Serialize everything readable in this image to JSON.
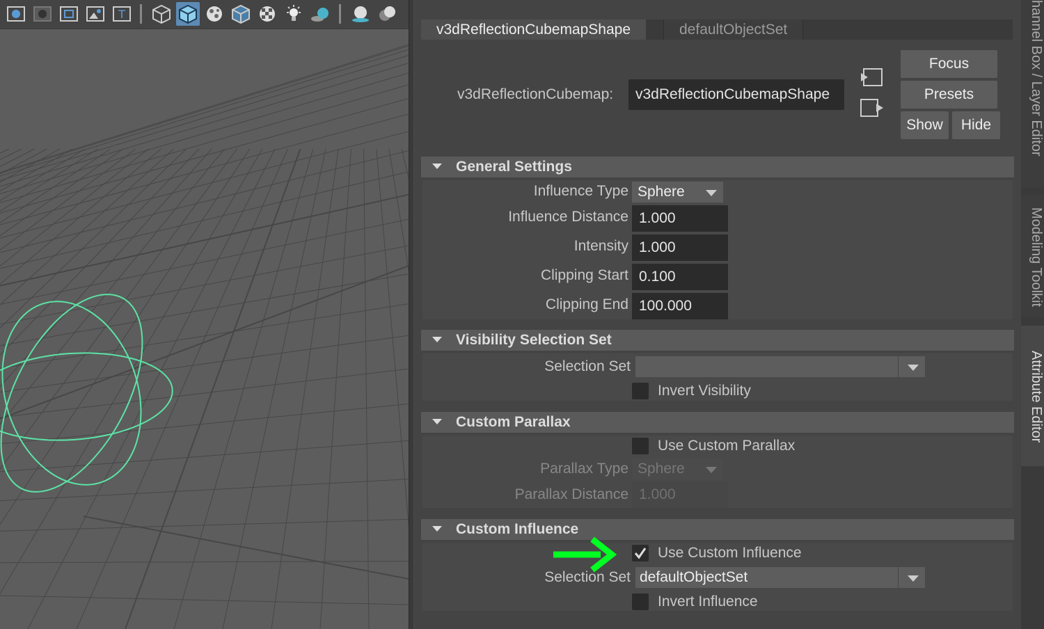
{
  "viewport": {
    "toolbar_icons": [
      "wireframe-on-shaded-icon",
      "shaded-icon",
      "frame-icon",
      "image-plane-icon",
      "texture-icon",
      "wireframe-cube-icon",
      "smooth-shaded-cube-icon",
      "isolate-icon",
      "xray-cube-icon",
      "checker-icon",
      "light-icon",
      "shadow-icon",
      "ambient-occlusion-icon",
      "motion-blur-icon"
    ],
    "colors": {
      "grid": "#474747",
      "curve": "#5ce3a6",
      "background": "#5d5d5d"
    }
  },
  "tabs": {
    "active": "v3dReflectionCubemapShape",
    "inactive": "defaultObjectSet"
  },
  "node": {
    "label": "v3dReflectionCubemap:",
    "value": "v3dReflectionCubemapShape"
  },
  "buttons": {
    "focus": "Focus",
    "presets": "Presets",
    "show": "Show",
    "hide": "Hide"
  },
  "general": {
    "title": "General Settings",
    "influence_type_label": "Influence Type",
    "influence_type_value": "Sphere",
    "influence_distance_label": "Influence Distance",
    "influence_distance_value": "1.000",
    "intensity_label": "Intensity",
    "intensity_value": "1.000",
    "clipping_start_label": "Clipping Start",
    "clipping_start_value": "0.100",
    "clipping_end_label": "Clipping End",
    "clipping_end_value": "100.000"
  },
  "visibility": {
    "title": "Visibility Selection Set",
    "selection_set_label": "Selection Set",
    "selection_set_value": "",
    "invert_label": "Invert Visibility",
    "invert_checked": false
  },
  "parallax": {
    "title": "Custom Parallax",
    "use_label": "Use Custom Parallax",
    "use_checked": false,
    "type_label": "Parallax Type",
    "type_value": "Sphere",
    "distance_label": "Parallax Distance",
    "distance_value": "1.000"
  },
  "influence": {
    "title": "Custom Influence",
    "use_label": "Use Custom Influence",
    "use_checked": true,
    "selection_set_label": "Selection Set",
    "selection_set_value": "defaultObjectSet",
    "invert_label": "Invert Influence",
    "invert_checked": false
  },
  "side_tabs": {
    "channel_box": "hannel Box / Layer Editor",
    "modeling_toolkit": "Modeling Toolkit",
    "attribute_editor": "Attribute Editor"
  },
  "annotation": {
    "arrow_color": "#00ff22"
  }
}
